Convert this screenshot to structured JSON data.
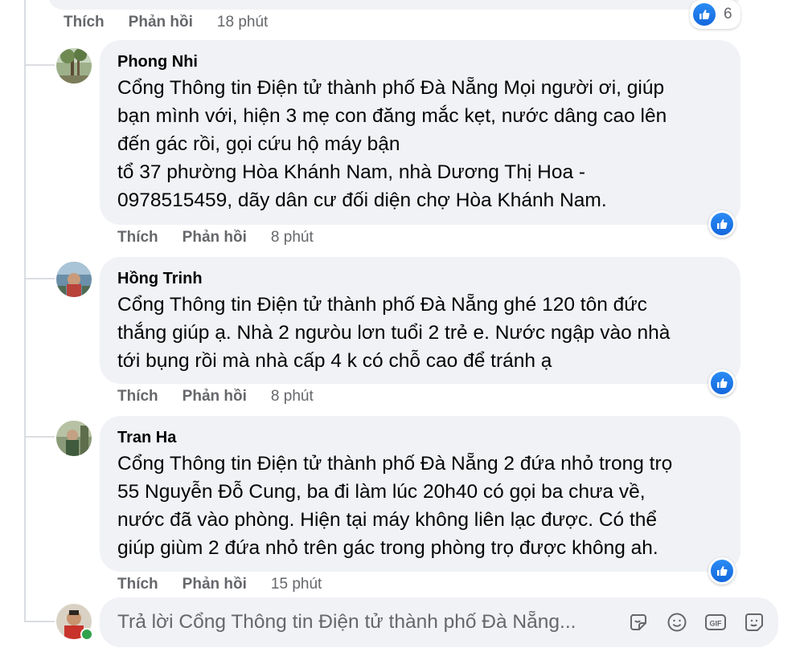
{
  "top_comment": {
    "actions": {
      "like": "Thích",
      "reply": "Phản hồi",
      "time": "18 phút"
    },
    "reaction_count": "6"
  },
  "comments": [
    {
      "author": "Phong Nhi",
      "lines": [
        "Cổng Thông tin Điện tử thành phố Đà Nẵng Mọi người ơi, giúp",
        "bạn mình với, hiện 3 mẹ con đăng mắc kẹt, nước dâng cao lên",
        "đến gác rồi, gọi cứu hộ máy bận",
        "tổ 37 phường Hòa Khánh Nam, nhà Dương Thị Hoa -",
        "0978515459, dãy dân cư đối diện chợ Hòa Khánh Nam."
      ],
      "actions": {
        "like": "Thích",
        "reply": "Phản hồi",
        "time": "8 phút"
      }
    },
    {
      "author": "Hồng Trinh",
      "lines": [
        "Cổng Thông tin Điện tử thành phố Đà Nẵng ghé 120 tôn đức",
        "thắng giúp ạ. Nhà 2 ngưòu lơn tuổi 2 trẻ e. Nước ngập vào nhà",
        "tới bụng rồi mà nhà cấp 4 k có chỗ cao để tránh ạ"
      ],
      "actions": {
        "like": "Thích",
        "reply": "Phản hồi",
        "time": "8 phút"
      }
    },
    {
      "author": "Tran Ha",
      "lines": [
        "Cổng Thông tin Điện tử thành phố Đà Nẵng 2 đứa nhỏ trong trọ",
        "55 Nguyễn Đỗ Cung, ba đi làm lúc 20h40 có gọi ba chưa về,",
        "nước đã vào phòng. Hiện tại máy không liên lạc được. Có thể",
        "giúp giùm 2 đứa nhỏ trên gác trong phòng trọ được không ah."
      ],
      "actions": {
        "like": "Thích",
        "reply": "Phản hồi",
        "time": "15 phút"
      }
    }
  ],
  "composer": {
    "placeholder": "Trả lời Cổng Thông tin Điện tử thành phố Đà Nẵng...",
    "tools": [
      "sticker-icon",
      "emoji-icon",
      "gif-icon",
      "avatar-sticker-icon"
    ]
  },
  "colors": {
    "bubble": "#f0f2f5",
    "like_blue": "#1877f2",
    "muted_text": "#65676b",
    "online": "#31a24c"
  }
}
